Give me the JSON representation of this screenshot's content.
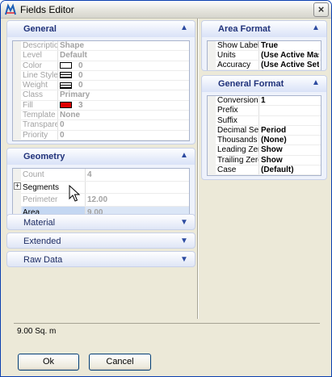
{
  "window": {
    "title": "Fields Editor",
    "close_glyph": "×"
  },
  "left": {
    "general": {
      "title": "General",
      "rows": [
        {
          "label": "Description",
          "value": "Shape"
        },
        {
          "label": "Level",
          "value": "Default"
        },
        {
          "label": "Color",
          "value": "0",
          "swatch": "#ffffff"
        },
        {
          "label": "Line Style",
          "value": "0",
          "swatch": "lines"
        },
        {
          "label": "Weight",
          "value": "0",
          "swatch": "lines"
        },
        {
          "label": "Class",
          "value": "Primary"
        },
        {
          "label": "Fill",
          "value": "3",
          "swatch": "#e00000"
        },
        {
          "label": "Template",
          "value": "None"
        },
        {
          "label": "Transparer",
          "value": "0"
        },
        {
          "label": "Priority",
          "value": "0"
        }
      ]
    },
    "geometry": {
      "title": "Geometry",
      "rows": [
        {
          "label": "Count",
          "value": "4"
        },
        {
          "label": "Segments",
          "value": "",
          "expander": "+"
        },
        {
          "label": "Perimeter",
          "value": "12.00"
        },
        {
          "label": "Area",
          "value": "9.00"
        }
      ]
    },
    "material": {
      "title": "Material"
    },
    "extended": {
      "title": "Extended"
    },
    "raw_data": {
      "title": "Raw Data"
    }
  },
  "right": {
    "area_format": {
      "title": "Area Format",
      "rows": [
        {
          "label": "Show Label",
          "value": "True"
        },
        {
          "label": "Units",
          "value": "(Use Active Mast"
        },
        {
          "label": "Accuracy",
          "value": "(Use Active Setti"
        }
      ]
    },
    "general_format": {
      "title": "General Format",
      "rows": [
        {
          "label": "Conversion F",
          "value": "1"
        },
        {
          "label": "Prefix",
          "value": ""
        },
        {
          "label": "Suffix",
          "value": ""
        },
        {
          "label": "Decimal Sepa",
          "value": "Period"
        },
        {
          "label": "Thousands S",
          "value": "(None)"
        },
        {
          "label": "Leading Zero",
          "value": "Show"
        },
        {
          "label": "Trailing Zeros",
          "value": "Show"
        },
        {
          "label": "Case",
          "value": "(Default)"
        }
      ]
    }
  },
  "status": {
    "text": "9.00 Sq. m"
  },
  "buttons": {
    "ok": "Ok",
    "cancel": "Cancel"
  },
  "colors": {
    "accent": "#20327a",
    "panel_bg": "#eef2fb",
    "fill_red": "#e00000"
  }
}
